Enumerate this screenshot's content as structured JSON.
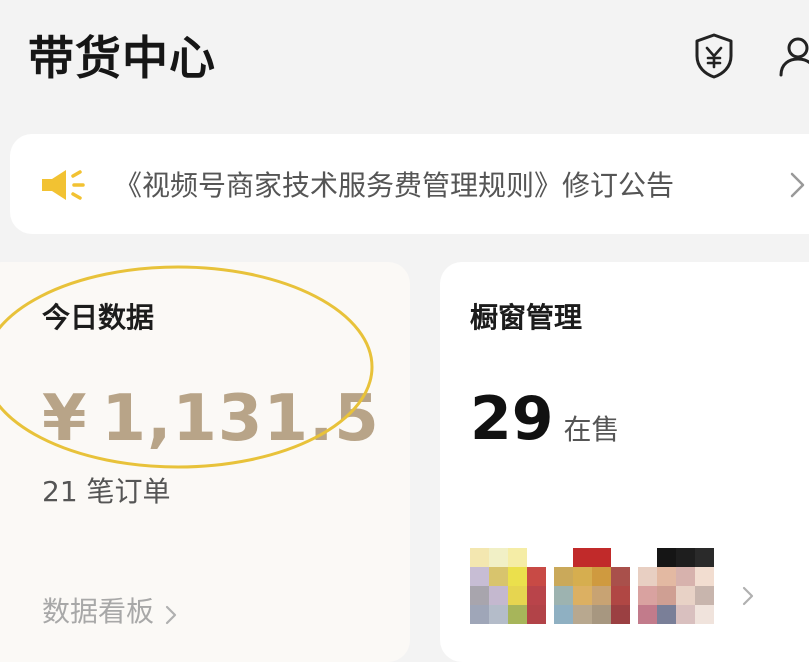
{
  "header": {
    "title": "带货中心",
    "icons": [
      "shield-yen-icon",
      "user-icon"
    ]
  },
  "notice": {
    "icon": "speaker-icon",
    "text": "《视频号商家技术服务费管理规则》修订公告"
  },
  "today_data": {
    "title": "今日数据",
    "currency": "¥",
    "amount": "1,131.5",
    "orders": "21 笔订单",
    "dashboard_link": "数据看板"
  },
  "window": {
    "title": "橱窗管理",
    "count": "29",
    "count_unit": "在售"
  },
  "colors": {
    "accent_yellow": "#f2c232",
    "amount_gold": "#b8a488",
    "highlight_circle": "#e8c23a"
  }
}
